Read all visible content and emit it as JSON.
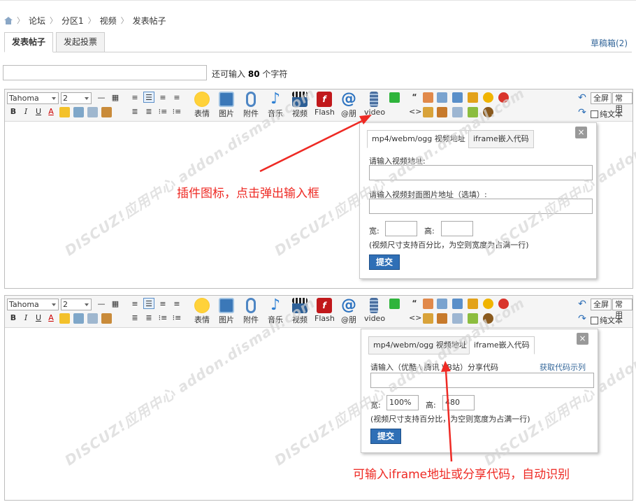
{
  "breadcrumb": [
    "论坛",
    "分区1",
    "视频",
    "发表帖子"
  ],
  "tabs": [
    "发表帖子",
    "发起投票"
  ],
  "drafts": "草稿箱(2)",
  "subject": {
    "remain_prefix": "还可输入",
    "remain_count": "80",
    "remain_suffix": "个字符"
  },
  "toolbar": {
    "font": "Tahoma",
    "size": "2",
    "bold": "B",
    "italic": "I",
    "underline": "U",
    "color": "A",
    "buttons": [
      "表情",
      "图片",
      "附件",
      "音乐",
      "视频",
      "Flash",
      "@朋",
      "video"
    ],
    "fullscreen": "全屏",
    "common": "常用",
    "plaintext": "纯文本"
  },
  "popup1": {
    "tabs": [
      "mp4/webm/ogg 视频地址",
      "iframe嵌入代码"
    ],
    "close": "×",
    "url_label": "请输入视频地址:",
    "cover_label": "请输入视频封面图片地址（选填）:",
    "width_label": "宽:",
    "height_label": "高:",
    "hint": "(视频尺寸支持百分比，为空则宽度为占满一行)",
    "submit": "提交"
  },
  "popup2": {
    "tabs": [
      "mp4/webm/ogg 视频地址",
      "iframe嵌入代码"
    ],
    "close": "×",
    "code_label": "请输入（优酷 \\ 腾讯 \\ B站）分享代码",
    "example_link": "获取代码示列",
    "width_label": "宽:",
    "width_value": "100%",
    "height_label": "高:",
    "height_value": "480",
    "hint": "(视频尺寸支持百分比，为空则宽度为占满一行)",
    "submit": "提交"
  },
  "annotations": {
    "plugin_icon": "插件图标，点击弹出输入框",
    "iframe_note": "可输入iframe地址或分享代码，自动识别"
  },
  "watermark": "DISCUZ!应用中心 addon.dismall.com",
  "colors": {
    "annotation": "#ee2a24",
    "link": "#336699",
    "submit": "#2f6fb6"
  }
}
